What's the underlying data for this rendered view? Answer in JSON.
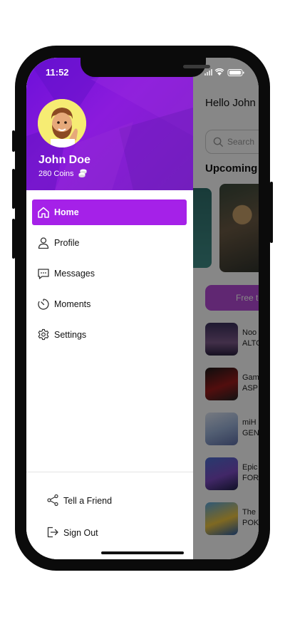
{
  "status_bar": {
    "time": "11:52"
  },
  "background_app": {
    "greeting": "Hello John",
    "search_placeholder": "Search",
    "section_title": "Upcoming G",
    "free_button": "Free to",
    "games": [
      {
        "line1": "Noo",
        "line2": "ALTO"
      },
      {
        "line1": "Gam",
        "line2": "ASP"
      },
      {
        "line1": "miH",
        "line2": "GEN"
      },
      {
        "line1": "Epic",
        "line2": "FOR"
      },
      {
        "line1": "The",
        "line2": "POK"
      }
    ]
  },
  "drawer": {
    "user": {
      "name": "John Doe",
      "coins": "280 Coins"
    },
    "menu": [
      {
        "label": "Home",
        "icon": "home-icon",
        "active": true
      },
      {
        "label": "Profile",
        "icon": "user-icon",
        "active": false
      },
      {
        "label": "Messages",
        "icon": "message-icon",
        "active": false
      },
      {
        "label": "Moments",
        "icon": "timer-icon",
        "active": false
      },
      {
        "label": "Settings",
        "icon": "gear-icon",
        "active": false
      }
    ],
    "footer": [
      {
        "label": "Tell a Friend",
        "icon": "share-icon"
      },
      {
        "label": "Sign Out",
        "icon": "sign-out-icon"
      }
    ]
  },
  "colors": {
    "header_purple": "#7a16d9",
    "active_item": "#a521e8",
    "free_button": "#b64bd8"
  }
}
